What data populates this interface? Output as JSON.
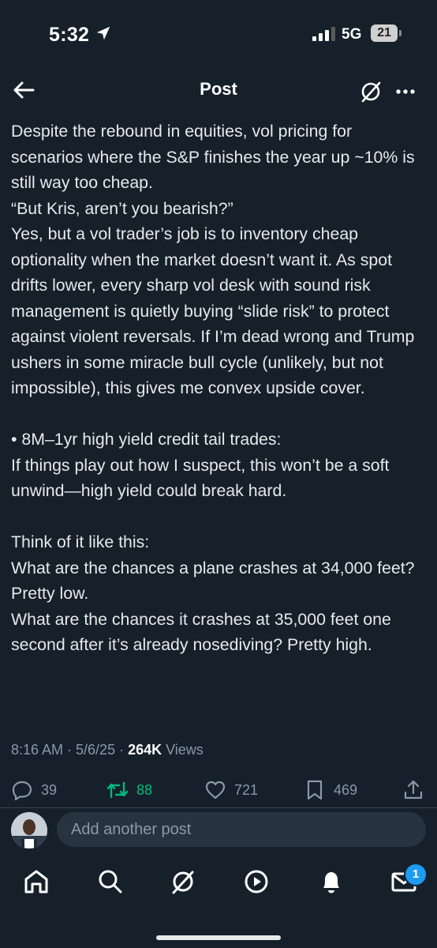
{
  "status_bar": {
    "time": "5:32",
    "network": "5G",
    "battery": "21"
  },
  "header": {
    "title": "Post"
  },
  "post": {
    "paragraphs": [
      "Despite the rebound in equities, vol pricing for scenarios where the S&P finishes the year up ~10% is still way too cheap.",
      "“But Kris, aren’t you bearish?”",
      "Yes, but a vol trader’s job is to inventory cheap optionality when the market doesn’t want it. As spot drifts lower, every sharp vol desk with sound risk management is quietly buying “slide risk” to protect against violent reversals. If I’m dead wrong and Trump ushers in some miracle bull cycle (unlikely, but not impossible), this gives me convex upside cover.",
      "• 8M–1yr high yield credit tail trades:",
      "If things play out how I suspect, this won’t be a soft unwind—high yield could break hard.",
      "Think of it like this:",
      "What are the chances a plane crashes at 34,000 feet? Pretty low.",
      "What are the chances it crashes at 35,000 feet one second after it’s already nosediving? Pretty high."
    ],
    "timestamp": "8:16 AM · 5/6/25 · ",
    "views_count": "264K",
    "views_label": " Views"
  },
  "actions": {
    "replies": "39",
    "reposts": "88",
    "likes": "721",
    "bookmarks": "469"
  },
  "reply": {
    "placeholder": "Add another post"
  },
  "tabbar": {
    "notifications_badge": "1"
  },
  "colors": {
    "background": "#15202b",
    "text": "#e7e9ea",
    "muted": "#8b98a5",
    "repost_green": "#00ba7c",
    "accent_blue": "#1d9bf0"
  }
}
